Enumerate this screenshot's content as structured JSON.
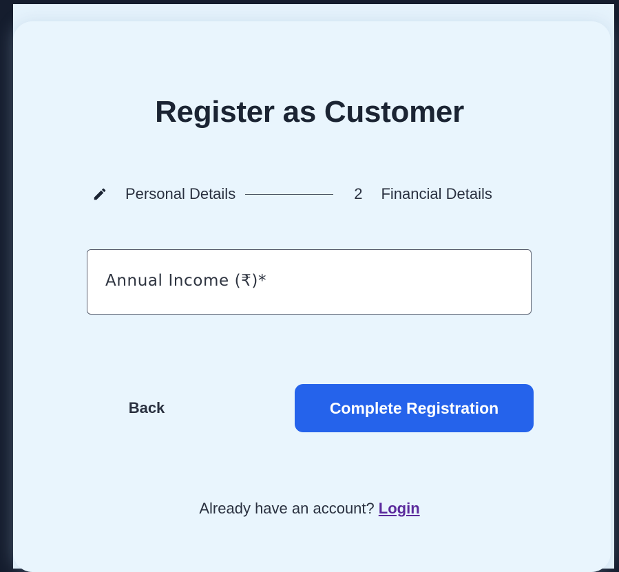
{
  "page": {
    "title": "Register as Customer"
  },
  "stepper": {
    "step1": {
      "icon": "pencil-icon",
      "label": "Personal Details"
    },
    "step2": {
      "number": "2",
      "label": "Financial Details"
    }
  },
  "form": {
    "annual_income": {
      "label": "Annual Income (₹)*",
      "value": ""
    }
  },
  "actions": {
    "back_label": "Back",
    "submit_label": "Complete Registration"
  },
  "footer": {
    "prompt": "Already have an account?",
    "login_label": "Login"
  },
  "colors": {
    "background": "#151d2e",
    "card": "#e9f5fd",
    "primary": "#2563eb",
    "link": "#5b2a9c"
  }
}
